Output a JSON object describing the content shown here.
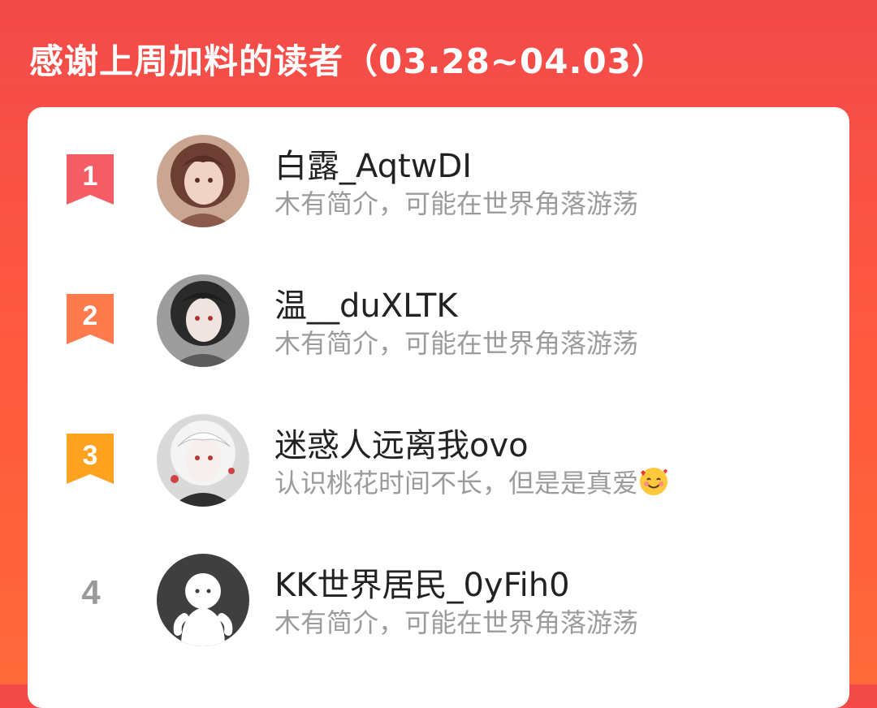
{
  "header": {
    "title": "感谢上周加料的读者（03.28~04.03）"
  },
  "readers": [
    {
      "rank": "1",
      "name": "白露_AqtwDI",
      "bio": "木有简介，可能在世界角落游荡",
      "badge_color": "#f45d66",
      "avatar_icon": "avatar-anime-girl-1"
    },
    {
      "rank": "2",
      "name": "温__duXLTK",
      "bio": "木有简介，可能在世界角落游荡",
      "badge_color": "#ff7a4d",
      "avatar_icon": "avatar-anime-girl-2"
    },
    {
      "rank": "3",
      "name": "迷惑人远离我ovo",
      "bio": "认识桃花时间不长，但是是真爱",
      "bio_emoji": "smiling-face-with-hearts-emoji",
      "badge_color": "#ffa21f",
      "avatar_icon": "avatar-anime-girl-3"
    },
    {
      "rank": "4",
      "name": "KK世界居民_0yFih0",
      "bio": "木有简介，可能在世界角落游荡",
      "avatar_icon": "avatar-default-ghost"
    }
  ]
}
